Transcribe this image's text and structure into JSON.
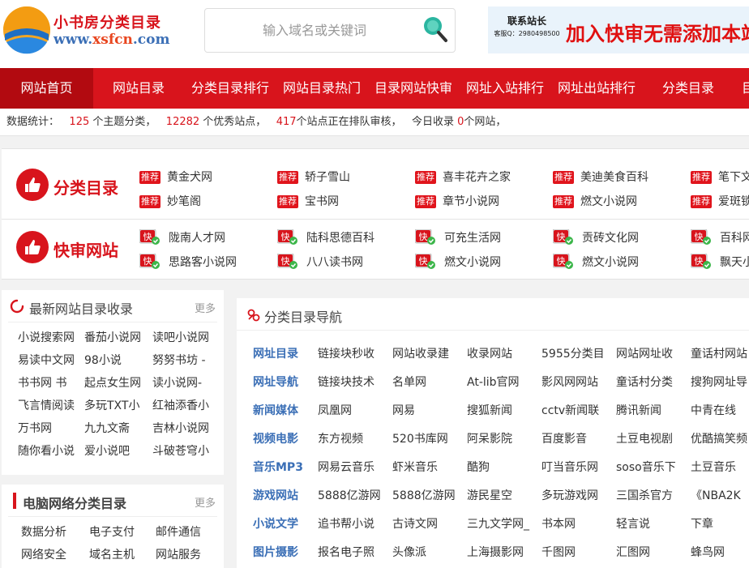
{
  "header": {
    "logo_title": "小书房分类目录",
    "logo_url_p1": "www.",
    "logo_url_p2": "xsfcn",
    "logo_url_p3": ".com",
    "search_placeholder": "输入域名或关键词",
    "ad_small_line1": "联系站长",
    "ad_small_line2": "客服Q：2980498500",
    "ad_big": "加入快审无需添加本站友链"
  },
  "nav": {
    "items": [
      "网站首页",
      "网站目录",
      "分类目录排行",
      "网站目录热门",
      "目录网站快审",
      "网址入站排行",
      "网址出站排行",
      "分类目录",
      "目"
    ]
  },
  "stats": {
    "label": "数据统计：",
    "topics_count": "125",
    "topics_suffix": " 个主题分类，",
    "sites_count": "12282",
    "sites_suffix": " 个优秀站点，",
    "queue_count": "417",
    "queue_suffix": "个站点正在排队审核，",
    "today_prefix": "今日收录 ",
    "today_count": "0",
    "today_suffix": "个网站，"
  },
  "featured": {
    "category_title": "分类目录",
    "tag_label": "推荐",
    "category_rows": [
      [
        "黄金犬网",
        "轿子雪山",
        "喜丰花卉之家",
        "美迪美食百科",
        "笔下文学"
      ],
      [
        "妙笔阁",
        "宝书网",
        "章节小说网",
        "燃文小说网",
        "爱斑锁"
      ]
    ],
    "fast_title": "快审网站",
    "fast_badge": "快",
    "fast_rows": [
      [
        "陇南人才网",
        "陆科思德百科",
        "可充生活网",
        "贡砖文化网",
        "百科网"
      ],
      [
        "思路客小说网",
        "八八读书网",
        "燃文小说网",
        "燃文小说网",
        "飘天小说"
      ]
    ]
  },
  "latest_panel": {
    "title": "最新网站目录收录",
    "more": "更多",
    "items": [
      [
        "小说搜索网",
        "番茄小说网",
        "读吧小说网"
      ],
      [
        "易读中文网",
        "98小说",
        "努努书坊 -"
      ],
      [
        "书书网 书",
        "起点女生网",
        "读小说网-"
      ],
      [
        "飞言情阅读",
        "多玩TXT小",
        "红袖添香小"
      ],
      [
        "万书网",
        "九九文斋",
        "吉林小说网"
      ],
      [
        "随你看小说",
        "爱小说吧",
        "斗破苍穹小"
      ]
    ]
  },
  "computer_panel": {
    "title": "电脑网络分类目录",
    "more": "更多",
    "items": [
      [
        "数据分析",
        "电子支付",
        "邮件通信"
      ],
      [
        "网络安全",
        "域名主机",
        "网站服务"
      ]
    ]
  },
  "nav_panel": {
    "title": "分类目录导航",
    "rows": [
      {
        "cat": "网址目录",
        "links": [
          "链接块秒收",
          "网站收录建",
          "收录网站",
          "5955分类目",
          "网站网址收",
          "童话村网站"
        ]
      },
      {
        "cat": "网址导航",
        "links": [
          "链接块技术",
          "名单网",
          "At-lib官网",
          "影风网网站",
          "童话村分类",
          "搜狗网址导"
        ]
      },
      {
        "cat": "新闻媒体",
        "links": [
          "凤凰网",
          "网易",
          "搜狐新闻",
          "cctv新闻联",
          "腾讯新闻",
          "中青在线"
        ]
      },
      {
        "cat": "视频电影",
        "links": [
          "东方视频",
          "520书库网",
          "阿呆影院",
          "百度影音",
          "土豆电视剧",
          "优酷搞笑频"
        ]
      },
      {
        "cat": "音乐MP3",
        "links": [
          "网易云音乐",
          "虾米音乐",
          "酷狗",
          "叮当音乐网",
          "soso音乐下",
          "土豆音乐"
        ]
      },
      {
        "cat": "游戏网站",
        "links": [
          "5888亿游网",
          "5888亿游网",
          "游民星空",
          "多玩游戏网",
          "三国杀官方",
          "《NBA2K"
        ]
      },
      {
        "cat": "小说文学",
        "links": [
          "追书帮小说",
          "古诗文网",
          "三九文学网_",
          "书本网",
          "轻言说",
          "下章"
        ]
      },
      {
        "cat": "图片摄影",
        "links": [
          "报名电子照",
          "头像派",
          "上海摄影网",
          "千图网",
          "汇图网",
          "蜂鸟网"
        ]
      }
    ]
  },
  "colors": {
    "brand_red": "#d8141c",
    "link_blue": "#3b6fb6"
  }
}
